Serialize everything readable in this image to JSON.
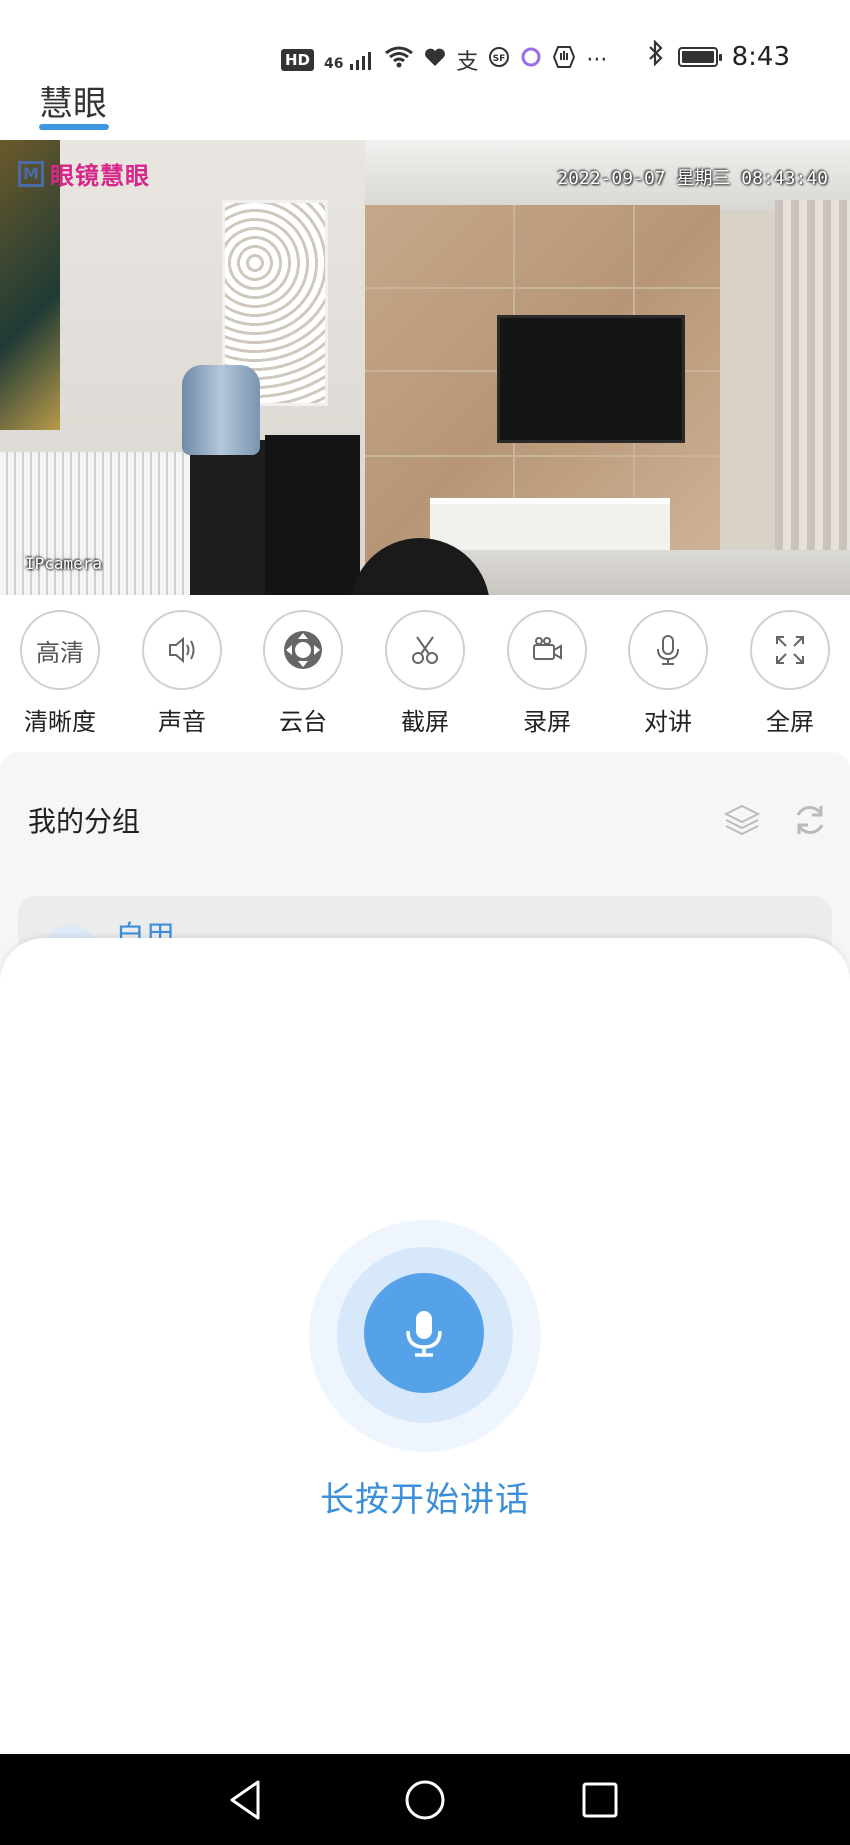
{
  "status_bar": {
    "hd": "HD",
    "net4g": "46",
    "wifi6": "6",
    "more": "···",
    "time": "8:43"
  },
  "app": {
    "title": "慧眼"
  },
  "camera": {
    "logo_text": "眼镜慧眼",
    "timestamp": "2022-09-07  星期三  08:43:40",
    "label": "IPcamera"
  },
  "controls": [
    {
      "icon_text": "高清",
      "label": "清晰度",
      "icon": "hd-quality-icon"
    },
    {
      "label": "声音",
      "icon": "speaker-icon"
    },
    {
      "label": "云台",
      "icon": "ptz-icon"
    },
    {
      "label": "截屏",
      "icon": "scissors-icon"
    },
    {
      "label": "录屏",
      "icon": "video-camera-icon"
    },
    {
      "label": "对讲",
      "icon": "microphone-icon"
    },
    {
      "label": "全屏",
      "icon": "fullscreen-icon"
    }
  ],
  "group": {
    "title": "我的分组",
    "card_name": "自用"
  },
  "talk": {
    "hint": "长按开始讲话",
    "accent": "#56a2e9"
  },
  "colors": {
    "accent": "#3d97e0",
    "text_blue": "#3d8fd9"
  }
}
